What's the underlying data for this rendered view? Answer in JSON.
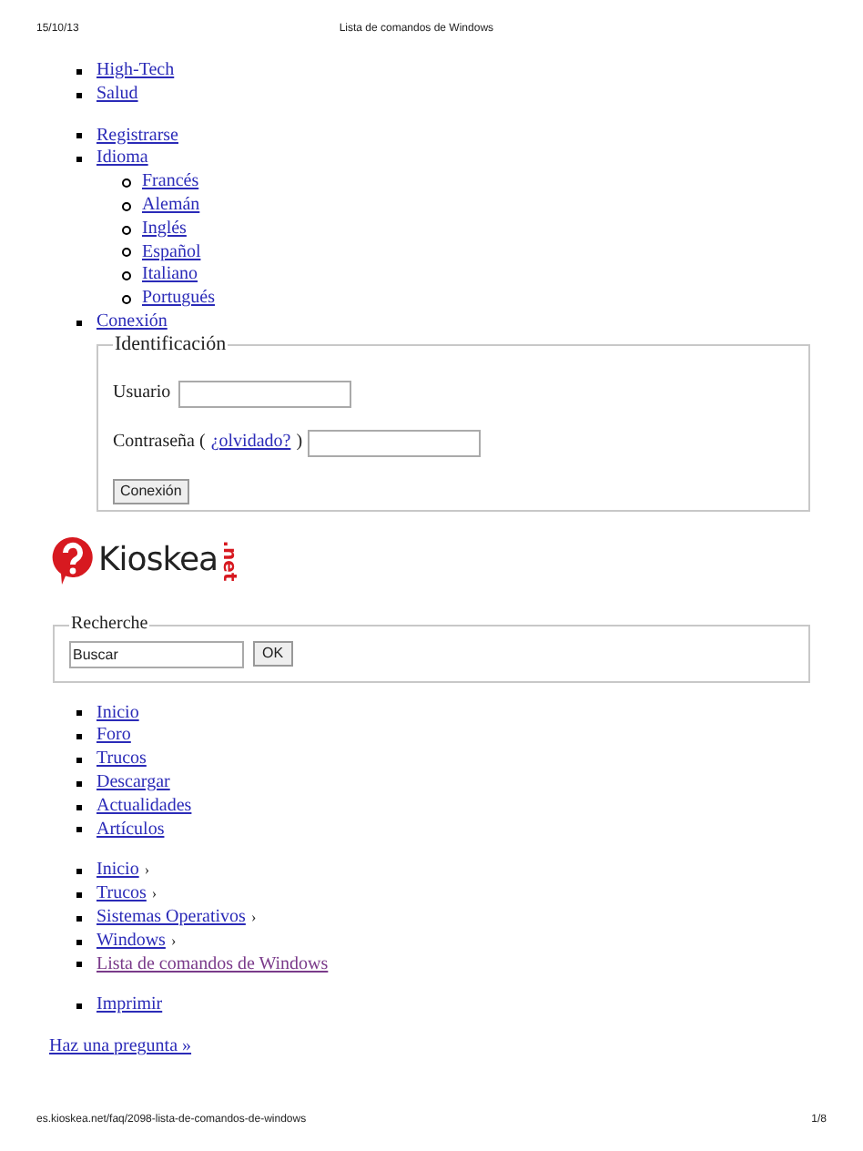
{
  "header": {
    "date": "15/10/13",
    "title": "Lista de comandos de Windows"
  },
  "top_links": [
    "High-Tech",
    "Salud"
  ],
  "user_menu": [
    {
      "label": "Registrarse"
    },
    {
      "label": "Idioma",
      "children": [
        "Francés",
        "Alemán",
        "Inglés",
        "Español",
        "Italiano",
        "Portugués"
      ]
    },
    {
      "label": "Conexión"
    }
  ],
  "login": {
    "legend": "Identificación",
    "username_label": "Usuario",
    "password_label": "Contraseña (",
    "forgot_link": "¿olvidado?",
    "password_close": ")",
    "button": "Conexión"
  },
  "logo": {
    "name": "Kioskea",
    "tld": ".net"
  },
  "search": {
    "legend": "Recherche",
    "value": "Buscar",
    "button": "OK"
  },
  "nav": [
    "Inicio",
    "Foro",
    "Trucos",
    "Descargar",
    "Actualidades",
    "Artículos"
  ],
  "breadcrumbs": [
    {
      "label": "Inicio",
      "separator": "›",
      "visited": false
    },
    {
      "label": "Trucos",
      "separator": "›",
      "visited": false
    },
    {
      "label": "Sistemas Operativos",
      "separator": "›",
      "visited": false
    },
    {
      "label": "Windows",
      "separator": "›",
      "visited": false
    },
    {
      "label": "Lista de comandos de Windows",
      "visited": true
    }
  ],
  "actions": [
    "Imprimir"
  ],
  "ask_link": "Haz una pregunta »",
  "footer": {
    "url": "es.kioskea.net/faq/2098-lista-de-comandos-de-windows",
    "page": "1/8"
  }
}
